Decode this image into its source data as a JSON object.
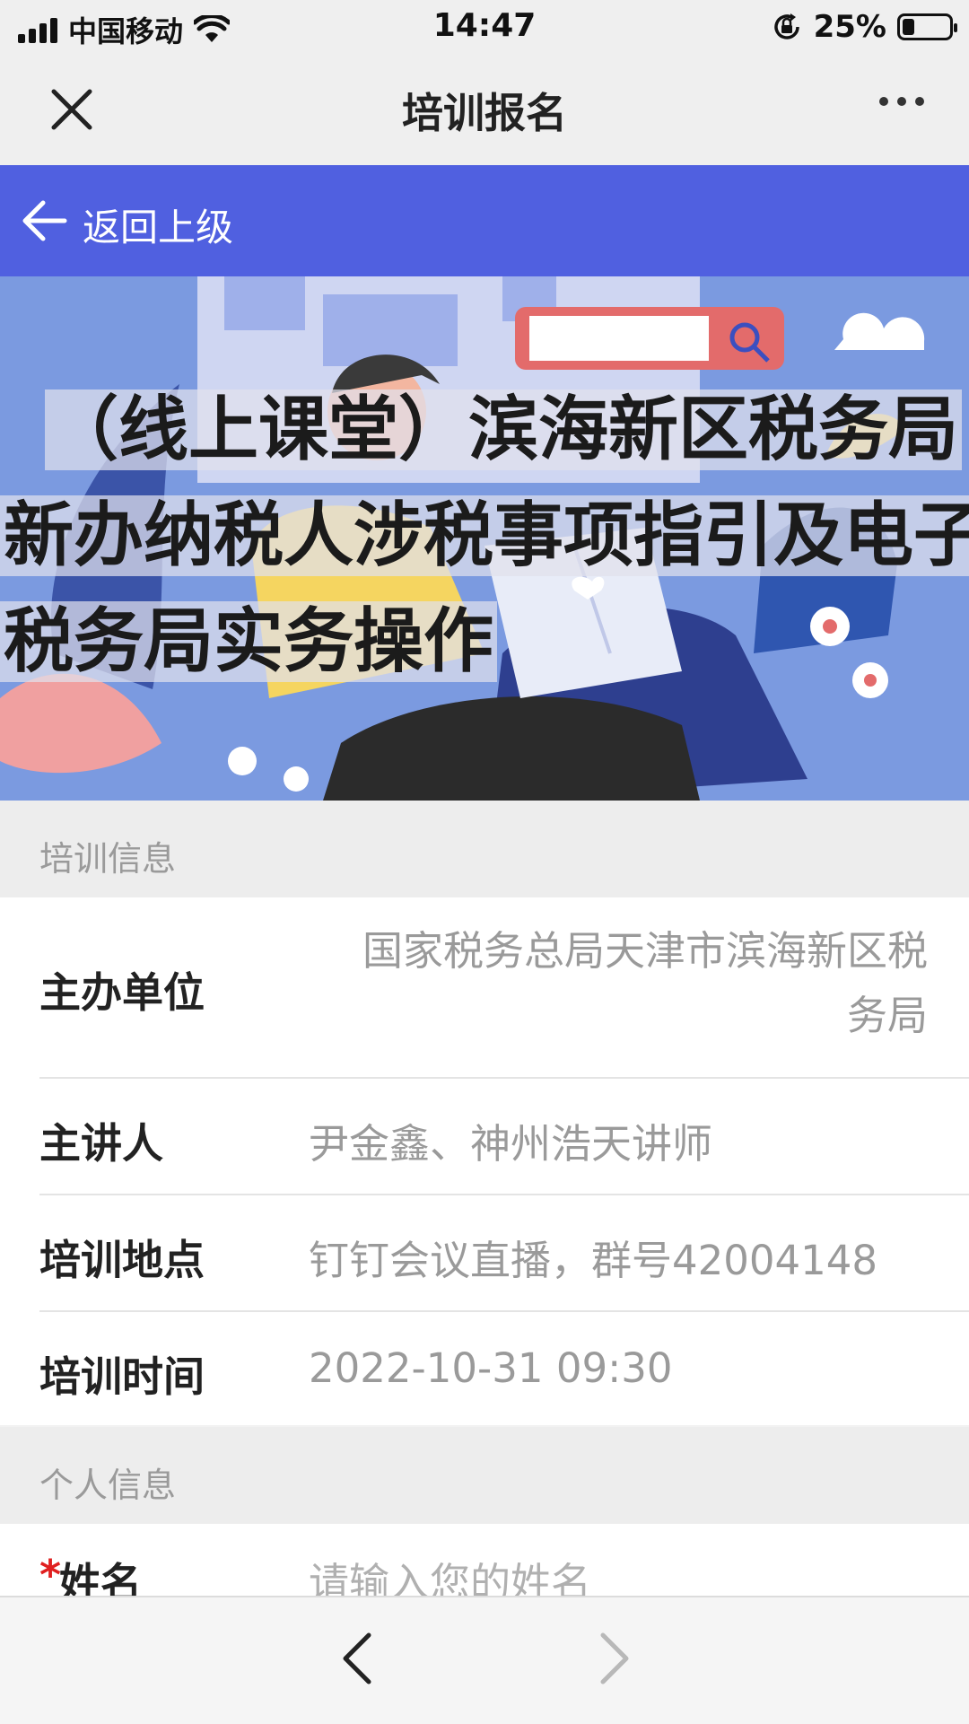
{
  "status_bar": {
    "carrier": "中国移动",
    "time": "14:47",
    "battery_percent": "25%",
    "battery_level": 0.25
  },
  "title_bar": {
    "title": "培训报名",
    "close_icon": "close-icon",
    "more_icon": "more-icon"
  },
  "back_bar": {
    "label": "返回上级"
  },
  "banner": {
    "title_lines": [
      "（线上课堂）滨海新区税务局",
      "新办纳税人涉税事项指引及电子",
      "税务局实务操作"
    ]
  },
  "training_info": {
    "section_label": "培训信息",
    "rows": [
      {
        "label": "主办单位",
        "value": "国家税务总局天津市滨海新区税务局"
      },
      {
        "label": "主讲人",
        "value": "尹金鑫、神州浩天讲师"
      },
      {
        "label": "培训地点",
        "value": "钉钉会议直播，群号42004148"
      },
      {
        "label": "培训时间",
        "value": "2022-10-31 09:30"
      }
    ]
  },
  "personal_info": {
    "section_label": "个人信息",
    "name_field": {
      "required_mark": "*",
      "label": "姓名",
      "placeholder": "请输入您的姓名",
      "value": ""
    }
  },
  "colors": {
    "brand_blue": "#5060e0",
    "required_red": "#e02020",
    "muted_text": "#9a9a9a"
  }
}
